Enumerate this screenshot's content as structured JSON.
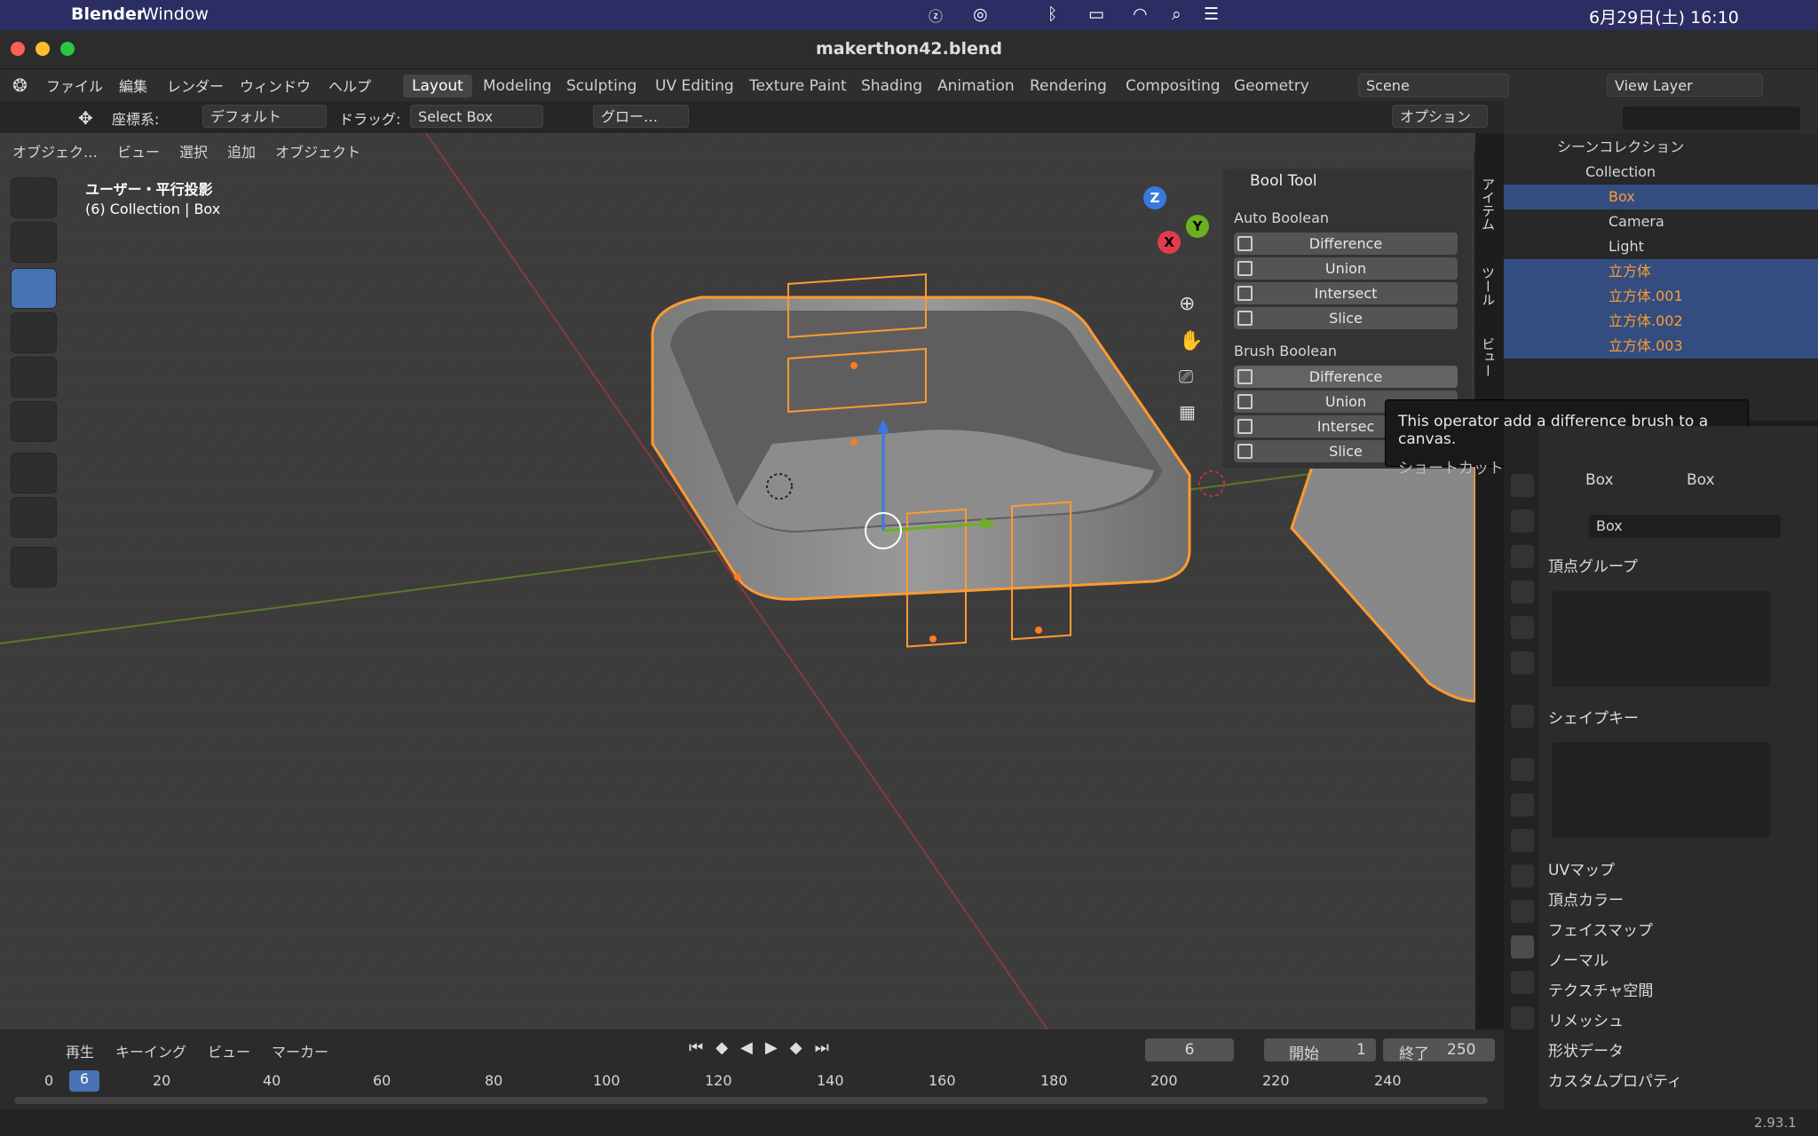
{
  "macbar": {
    "app": "Blender",
    "menu": "Window",
    "clock": "6月29日(土) 16:10"
  },
  "window": {
    "title": "makerthon42.blend"
  },
  "menus": [
    "ファイル",
    "編集",
    "レンダー",
    "ウィンドウ",
    "ヘルプ"
  ],
  "workspaces": [
    "Layout",
    "Modeling",
    "Sculpting",
    "UV Editing",
    "Texture Paint",
    "Shading",
    "Animation",
    "Rendering",
    "Compositing",
    "Geometry"
  ],
  "scene": "Scene",
  "view_layer": "View Layer",
  "toolheader": {
    "coord_label": "座標系:",
    "coord_value": "デフォルト",
    "drag_label": "ドラッグ:",
    "drag_value": "Select Box",
    "transform_value": "グロー…",
    "options": "オプション"
  },
  "viewmenu": [
    "オブジェク…",
    "ビュー",
    "選択",
    "追加",
    "オブジェクト"
  ],
  "viewport_info": {
    "line1": "ユーザー・平行投影",
    "line2": "(6) Collection | Box"
  },
  "gizmo": {
    "x": "X",
    "y": "Y",
    "z": "Z"
  },
  "side_tabs": [
    "アイテム",
    "ツール",
    "ビュー"
  ],
  "bool_tool": {
    "title": "Bool Tool",
    "auto_title": "Auto Boolean",
    "auto": [
      "Difference",
      "Union",
      "Intersect",
      "Slice"
    ],
    "brush_title": "Brush Boolean",
    "brush": [
      "Difference",
      "Union",
      "Intersec",
      "Slice"
    ]
  },
  "tooltip": {
    "line1": "This operator add a difference brush to a canvas.",
    "line2": "ショートカット: ^ テンキー[ - ]"
  },
  "outliner": {
    "root": "シーンコレクション",
    "collection": "Collection",
    "items": [
      "Box",
      "Camera",
      "Light",
      "立方体",
      "立方体.001",
      "立方体.002",
      "立方体.003"
    ]
  },
  "properties": {
    "breadcrumb_obj": "Box",
    "breadcrumb_mesh": "Box",
    "mesh_name": "Box",
    "sections": [
      "頂点グループ",
      "シェイプキー",
      "UVマップ",
      "頂点カラー",
      "フェイスマップ",
      "ノーマル",
      "テクスチャ空間",
      "リメッシュ",
      "形状データ",
      "カスタムプロパティ"
    ]
  },
  "timeline": {
    "menus": [
      "再生",
      "キーイング",
      "ビュー",
      "マーカー"
    ],
    "current_frame": "6",
    "start_label": "開始",
    "start": "1",
    "end_label": "終了",
    "end": "250",
    "ticks": [
      "0",
      "6",
      "20",
      "40",
      "60",
      "80",
      "100",
      "120",
      "140",
      "160",
      "180",
      "200",
      "220",
      "240"
    ]
  },
  "status": {
    "version": "2.93.1"
  },
  "colors": {
    "accent": "#4772b3",
    "selection": "#ff9a30",
    "menubar": "#2c2d63"
  }
}
